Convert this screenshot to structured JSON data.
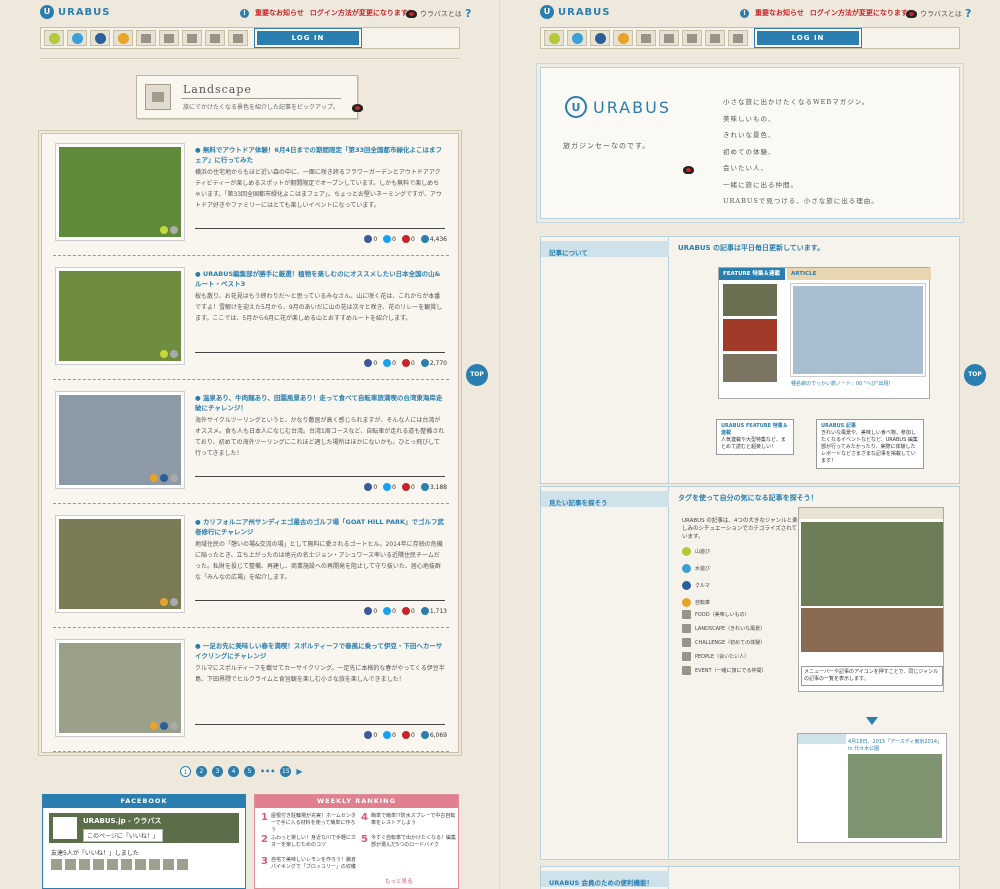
{
  "left": {
    "header": {
      "logo_text": "URABUS",
      "notice_label": "重要なお知らせ",
      "notice_text": "ログイン方法が変更になります！",
      "whatis": "ウラバスとは",
      "whatis_q": "?"
    },
    "nav": {
      "login_label": "LOG IN",
      "icons": [
        "mountain-icon",
        "water-icon",
        "car-icon",
        "bicycle-icon",
        "food-icon",
        "landscape-icon",
        "challenge-icon",
        "people-icon",
        "event-icon"
      ]
    },
    "category": {
      "title": "Landscape",
      "subtitle": "旅にでかけたくなる景色を紹介した記事をピックアップ。"
    },
    "articles": [
      {
        "title": "● 無料でアウトドア体験！6月4日までの期間限定「第33回全国都市緑化よこはまフェア」に行ってみた",
        "desc": "横浜の住宅地からもほど近い森の中に、一面に咲き誇るフラワーガーデンとアウトドアアクティビティーが楽しめるスポットが期間限定でオープンしています。しかも無料で楽しめちゃいます。「第33回全国都市緑化よこはまフェア」。ちょっとお堅いネーミングですが、アウトドア好きやファミリーにはとても楽しいイベントになっています。",
        "shares": [
          "0",
          "0",
          "0",
          "4,436"
        ],
        "img_color": "#5f8a3a"
      },
      {
        "title": "● URABUS編集部が勝手に厳選！植物を楽しむのにオススメしたい日本全国の山&ルート・ベスト3",
        "desc": "桜も散り、お花見はもう終わりだ〜と思っているみなさん。山に咲く花は、これからが本番ですよ！雪解けを迎えた5月から、9月のあいだに山の花は次々と咲き、花のリレーを観賞します。ここでは、5月から6月に花が楽しめる山とおすすめルートを紹介します。",
        "shares": [
          "0",
          "0",
          "0",
          "2,770"
        ],
        "img_color": "#6f8d3e"
      },
      {
        "title": "● 温泉あり、牛肉麺あり、田園風景あり！走って食べて自転車旅満喫の台湾東海岸走破にチャレンジ！",
        "desc": "海外サイクルツーリングというと、かなり敷居が高く感じられますが、そんな人には台湾がオススメ。食も人も日本人になじむ台湾。台湾1周コースなど、自転車が走れる道も整備されており、初めての海外ツーリングにこれほど適した場所はほかにないかも。ひとっ飛びして行ってきました！",
        "shares": [
          "0",
          "0",
          "0",
          "3,188"
        ],
        "img_color": "#8b9aa6"
      },
      {
        "title": "● カリフォルニア州サンディエゴ最古のゴルフ場「GOAT HILL PARK」でゴルフ武者修行にチャレンジ",
        "desc": "地域住民の「憩いの場&交流の場」として無料に愛されるゴートヒル。2014年に存続の危機に陥ったとき、立ち上がったのは地元の名士ジョン・アシュワース率いる近隣住民チームだった。私財を投じて整備、再建し、商業施設への再開発を阻止して守り抜いた、居心地抜群な「みんなの広場」を紹介します。",
        "shares": [
          "0",
          "0",
          "0",
          "1,713"
        ],
        "img_color": "#7a7a55"
      },
      {
        "title": "● 一足お先に美味しい春を満喫！スポルティーフで春風に乗って伊豆・下田へカーサイクリングにチャレンジ",
        "desc": "クルマにスポルティーフを載せてカーサイクリング。一足先に本格的な春がやってくる伊豆半島、下田界隈でヒルクライムと食旨観を楽しむ小さな旅を楽しんできました！",
        "shares": [
          "0",
          "0",
          "0",
          "6,069"
        ],
        "img_color": "#9aa08a"
      }
    ],
    "pager": {
      "pages": [
        "1",
        "2",
        "3",
        "4",
        "5"
      ],
      "ellipsis": "•••",
      "last": "15",
      "next": "▶"
    },
    "facebook": {
      "head": "FACEBOOK",
      "page_name": "URABUS.jp - ウラバス",
      "like_btn": "このページに「いいね！」",
      "count_text": "友達5人が「いいね！」しました"
    },
    "ranking": {
      "head": "WEEKLY RANKING",
      "items": [
        {
          "rank": "1",
          "text": "屋根付き駐輪場が充実！ホームセンターで手に入る材料を使って簡単に作ろう"
        },
        {
          "rank": "2",
          "text": "ふわっと楽しい！身近な川で手軽にカヌーを楽しむためのコツ"
        },
        {
          "rank": "3",
          "text": "自宅で美味しいレモンを作ろう！鎌倉パイキングで「ブロッコリー」の収穫"
        },
        {
          "rank": "4",
          "text": "簡単で簡単!?防水スプレーで中古自転車をレストアしよう"
        },
        {
          "rank": "5",
          "text": "今すぐ自転車で出かけたくなる！編集部が選んだ5つのロードバイク"
        }
      ],
      "more": "もっと見る"
    },
    "top_label": "TOP"
  },
  "right": {
    "hero": {
      "logo_mark": "U",
      "logo_text": "URABUS",
      "tagline": "旅ガジンセーなのです。",
      "poem": [
        "小さな旅に出かけたくなるWEBマガジン。",
        "美味しいもの、",
        "きれいな景色、",
        "初めての体験、",
        "会いたい人、",
        "一緒に旅に出る仲間。",
        "URABUSで見つける、小さな旅に出る理由。"
      ]
    },
    "about": {
      "tab": "記事について",
      "head": "URABUS の記事は平日毎日更新しています。",
      "feature_label": "FEATURE 特集＆連載",
      "article_label": "ARTICLE",
      "caption": "種名線のでっかい旅ノート：00 \"へび\"出現！",
      "bubble1_title": "URABUS FEATURE 特集＆連載",
      "bubble1_text": "人気連載や大型特集など、まとめて読むと超楽しい！",
      "bubble2_title": "URABUS 記事",
      "bubble2_text": "きれいな風景や、美味しい食べ物、参加したくなるイベントなどなど、URABUS 編集部が行ってみたかったり、実際に体験したレポートなどさまざまな記事を掲載しています！"
    },
    "tags": {
      "tab": "見たい記事を探そう",
      "head": "タグを使って自分の気になる記事を探そう！",
      "intro": "URABUS の記事は、4つの大きなジャンルと楽しみのシチュエーションでカテゴライズされています。",
      "items": [
        {
          "label": "山遊び",
          "color": "#b3c93a"
        },
        {
          "label": "水遊び",
          "color": "#3aa0d6"
        },
        {
          "label": "クルマ",
          "color": "#2b5e9a"
        },
        {
          "label": "自転車",
          "color": "#e8a32a"
        },
        {
          "label": "FOOD（美味しいもの）",
          "color": "sq"
        },
        {
          "label": "LANDSCAPE（きれいな風景）",
          "color": "sq"
        },
        {
          "label": "CHALLENGE（初めての体験）",
          "color": "sq"
        },
        {
          "label": "PEOPLE（会いたい人）",
          "color": "sq"
        },
        {
          "label": "EVENT（一緒に旅にでる仲間）",
          "color": "sq"
        }
      ],
      "note": "メニューバーや記事のアイコンを押すことで、同じジャンルの記事の一覧を表示します。",
      "shot_title": "4月18日、2015「アースディ東京2014」in 代々木公園"
    },
    "members": {
      "tab": "URABUS 会員のための便利機能！"
    },
    "top_label": "TOP"
  },
  "colors": {
    "accent": "#2a7fb0",
    "alert": "#c8252b",
    "ranking": "#e07f8e"
  }
}
